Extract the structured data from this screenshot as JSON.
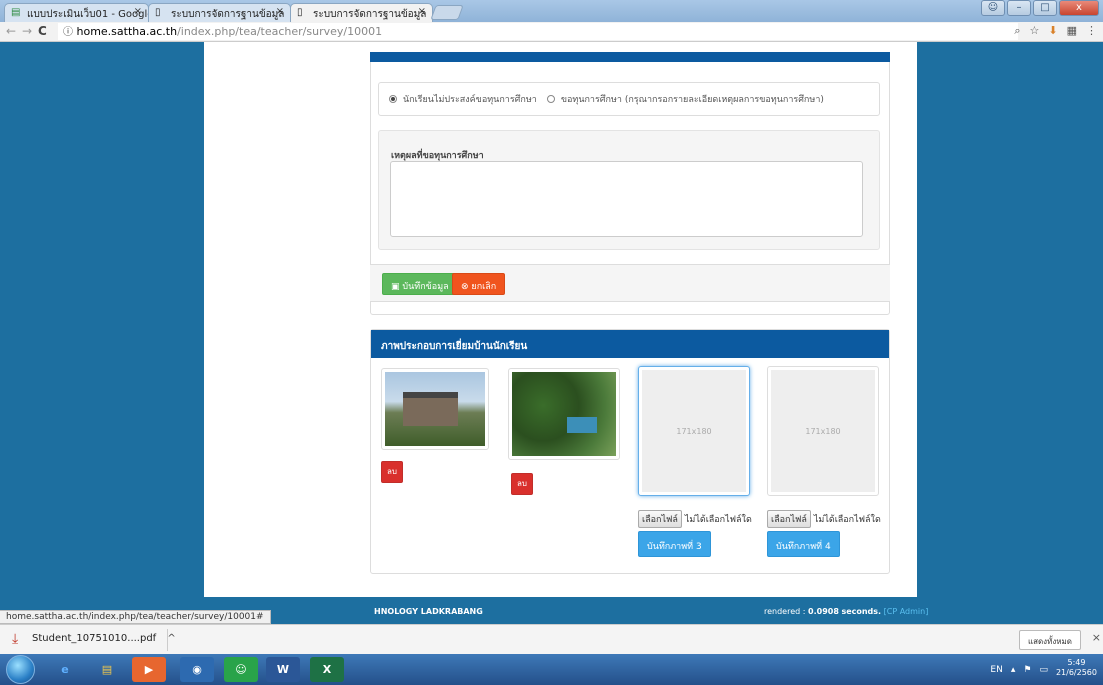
{
  "browser": {
    "tabs": [
      {
        "title": "แบบประเมินเว็บ01 - Google",
        "icon": "google-sheets-icon"
      },
      {
        "title": "ระบบการจัดการฐานข้อมูล",
        "icon": "page-icon"
      },
      {
        "title": "ระบบการจัดการฐานข้อมูล",
        "icon": "page-icon"
      }
    ],
    "url_host": "home.sattha.ac.th",
    "url_path": "/index.php/tea/teacher/survey/10001",
    "status_url": "home.sattha.ac.th/index.php/tea/teacher/survey/10001#"
  },
  "form": {
    "radio_option_1": "นักเรียนไม่ประสงค์ขอทุนการศึกษา",
    "radio_option_2": "ขอทุนการศึกษา (กรุณากรอกรายละเอียดเหตุผลการขอทุนการศึกษา)",
    "reason_label": "เหตุผลที่ขอทุนการศึกษา",
    "reason_value": "",
    "save_label": "บันทึกข้อมูล",
    "cancel_label": "ยกเลิก"
  },
  "photos": {
    "heading": "ภาพประกอบการเยี่ยมบ้านนักเรียน",
    "delete_label": "ลบ",
    "placeholder": "171x180",
    "choose_file_label": "เลือกไฟล์",
    "no_file_label": "ไม่ได้เลือกไฟล์ใด",
    "upload_3_label": "บันทึกภาพที่ 3",
    "upload_4_label": "บันทึกภาพที่ 4"
  },
  "site_footer": {
    "left": "HNOLOGY LADKRABANG",
    "rendered_prefix": "rendered :",
    "rendered_time": "0.0908",
    "rendered_suffix": "seconds.",
    "admin_link": "[CP Admin]"
  },
  "downloads": {
    "file_name": "Student_10751010....pdf",
    "show_all": "แสดงทั้งหมด"
  },
  "taskbar": {
    "lang": "EN",
    "time": "5:49",
    "date": "21/6/2560"
  },
  "colors": {
    "page_bg": "#1d6fa0",
    "panel_header": "#0c5aa0",
    "save_green": "#5cb85c",
    "cancel_orange": "#f0541e",
    "delete_red": "#d9302c",
    "upload_blue": "#3ba5e8"
  }
}
